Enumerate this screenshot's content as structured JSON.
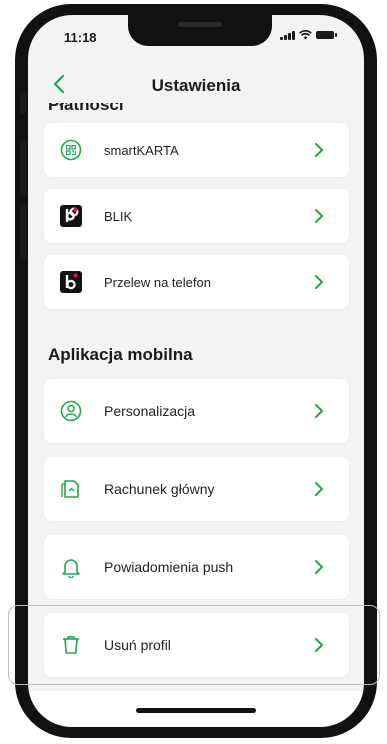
{
  "status_bar": {
    "time": "11:18"
  },
  "header": {
    "title": "Ustawienia"
  },
  "payments_section": {
    "title_cut": "Płatności",
    "items": [
      {
        "label": "smartKARTA",
        "icon": "smartcard-icon"
      },
      {
        "label": "BLIK",
        "icon": "blik-icon"
      },
      {
        "label": "Przelew na telefon",
        "icon": "blik-icon"
      }
    ]
  },
  "mobile_section": {
    "title": "Aplikacja mobilna",
    "items": [
      {
        "label": "Personalizacja",
        "icon": "user-icon"
      },
      {
        "label": "Rachunek główny",
        "icon": "document-icon"
      },
      {
        "label": "Powiadomienia push",
        "icon": "bell-icon"
      },
      {
        "label": "Usuń profil",
        "icon": "trash-icon"
      }
    ]
  },
  "colors": {
    "accent": "#1fa84f",
    "background": "#f3f3f3",
    "card": "#ffffff"
  }
}
